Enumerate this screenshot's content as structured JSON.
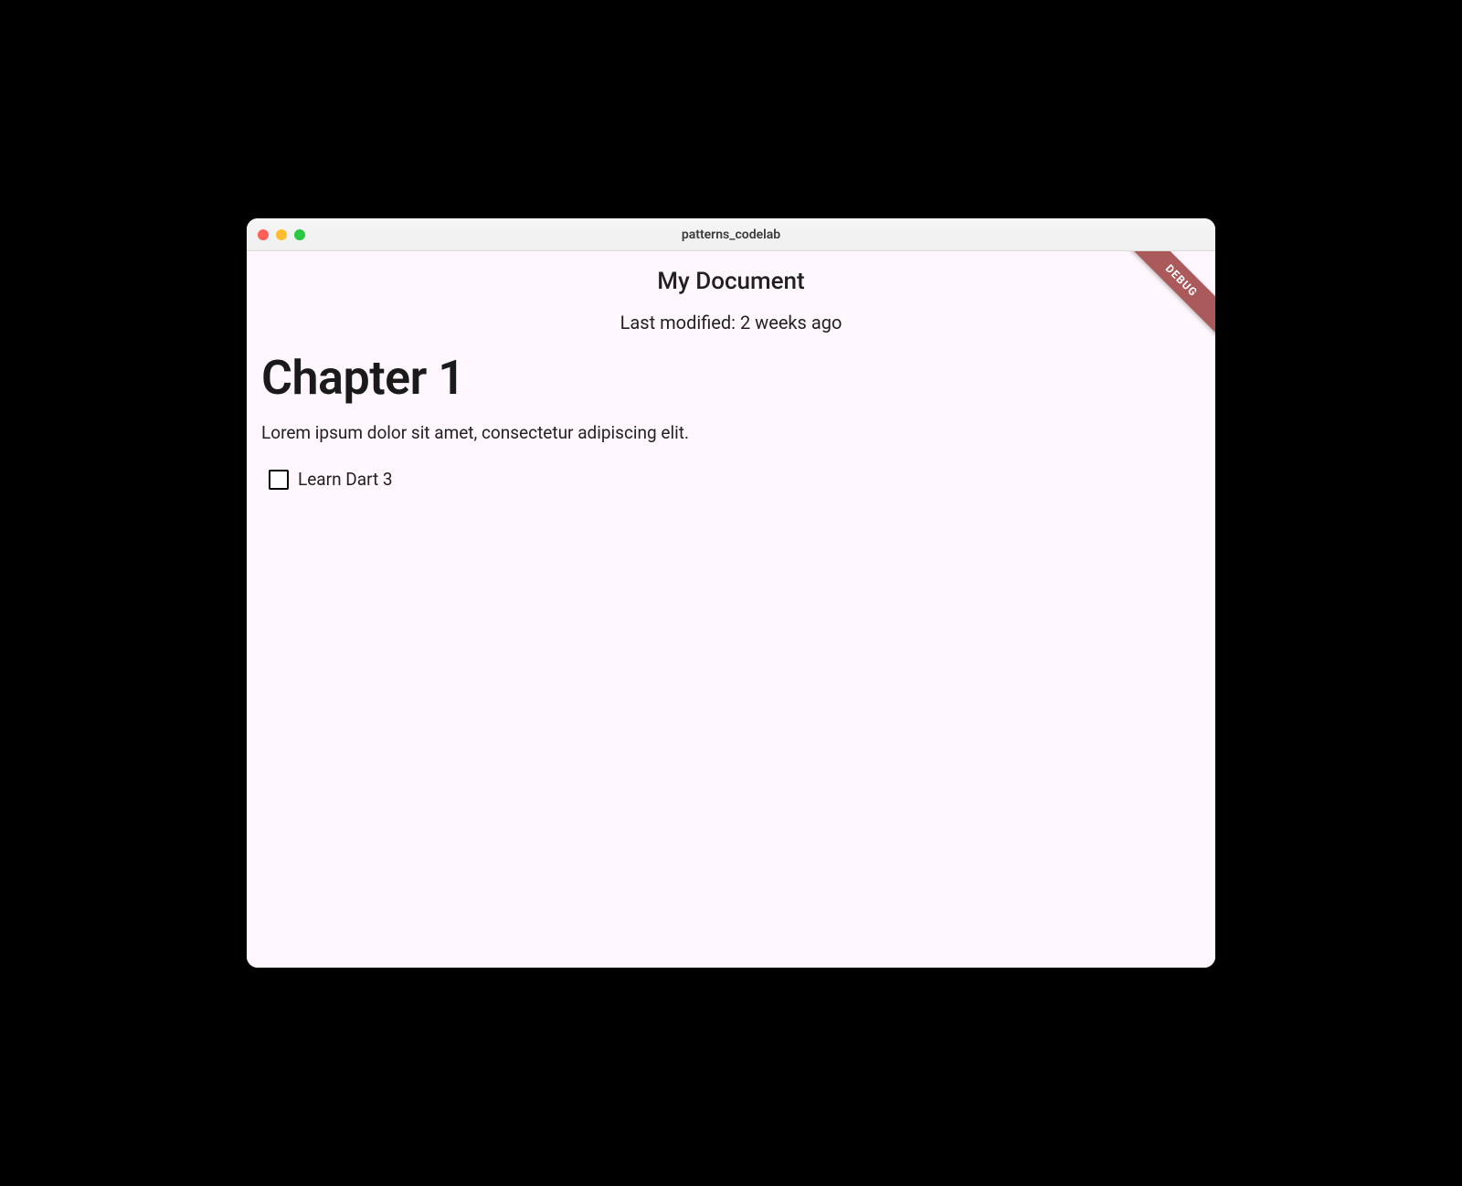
{
  "window": {
    "title": "patterns_codelab"
  },
  "app": {
    "title": "My Document",
    "subtitle": "Last modified: 2 weeks ago",
    "debug_banner": "DEBUG"
  },
  "content": {
    "heading": "Chapter 1",
    "body": "Lorem ipsum dolor sit amet, consectetur adipiscing elit.",
    "checkbox": {
      "label": "Learn Dart 3",
      "checked": false
    }
  }
}
